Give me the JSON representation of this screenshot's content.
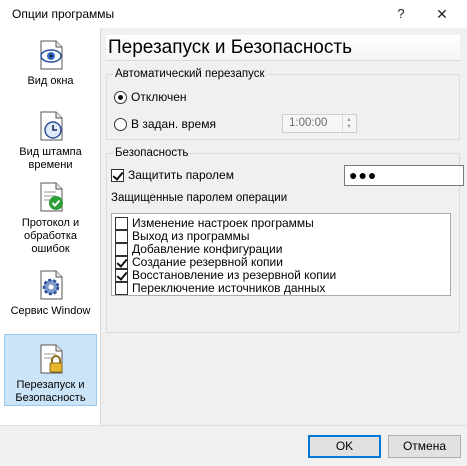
{
  "window": {
    "title": "Опции программы",
    "help_glyph": "?",
    "close_glyph": "✕"
  },
  "sidebar": {
    "items": [
      {
        "label": "Вид окна",
        "icon": "document-eye-icon",
        "active": false
      },
      {
        "label": "Вид штампа времени",
        "icon": "document-clock-icon",
        "active": false
      },
      {
        "label": "Протокол и обработка ошибок",
        "icon": "document-check-icon",
        "active": false
      },
      {
        "label": "Сервис Window",
        "icon": "document-gear-icon",
        "active": false
      },
      {
        "label": "Перезапуск и Безопасность",
        "icon": "document-lock-icon",
        "active": true
      }
    ]
  },
  "main": {
    "title": "Перезапуск и Безопасность",
    "autorestart": {
      "legend": "Автоматический перезапуск",
      "option_off": "Отключен",
      "option_at_time": "В задан. время",
      "selected": "off",
      "time_value": "1:00:00"
    },
    "security": {
      "legend": "Безопасность",
      "protect_label": "Защитить паролем",
      "protect_checked": true,
      "password_value": "●●●",
      "ops_label": "Защищенные паролем операции",
      "ops": [
        {
          "label": "Изменение настроек программы",
          "checked": false
        },
        {
          "label": "Выход из программы",
          "checked": false
        },
        {
          "label": "Добавление конфигурации",
          "checked": false
        },
        {
          "label": "Создание резервной копии",
          "checked": true
        },
        {
          "label": "Восстановление из резервной копии",
          "checked": true
        },
        {
          "label": "Переключение источников данных",
          "checked": false
        }
      ]
    }
  },
  "buttons": {
    "ok": "OK",
    "cancel": "Отмена"
  },
  "colors": {
    "active_item_bg": "#cce4f7",
    "active_item_border": "#99c9ef",
    "default_button_border": "#0078d7"
  }
}
